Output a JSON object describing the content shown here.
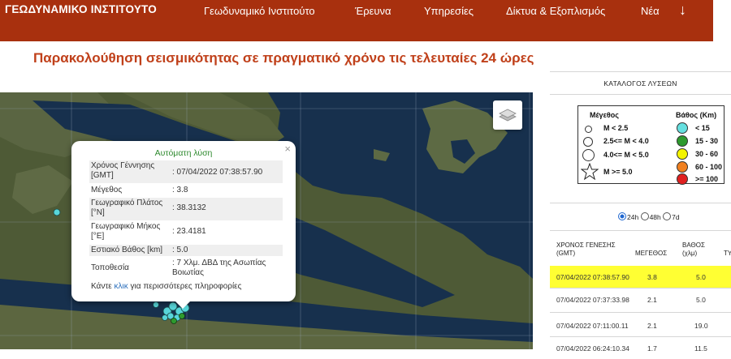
{
  "header": {
    "brand": "ΓΕΩΔΥΝΑΜΙΚΟ ΙΝΣΤΙΤΟΥΤΟ",
    "nav": [
      "Γεωδυναμικό Ινστιτούτο",
      "Έρευνα",
      "Υπηρεσίες",
      "Δίκτυα & Εξοπλισμός",
      "Νέα"
    ],
    "nav_arrow": "↓"
  },
  "page": {
    "title": "Παρακολούθηση σεισμικότητας σε πραγματικό χρόνο τις τελευταίες 24 ώρες"
  },
  "popup": {
    "title": "Αυτόματη λύση",
    "close": "×",
    "rows": [
      {
        "label": "Χρόνος Γέννησης [GMT]",
        "value": ": 07/04/2022 07:38:57.90"
      },
      {
        "label": "Μέγεθος",
        "value": ": 3.8"
      },
      {
        "label": "Γεωγραφικό Πλάτος [°N]",
        "value": ": 38.3132"
      },
      {
        "label": "Γεωγραφικό Μήκος [°E]",
        "value": ": 23.4181"
      },
      {
        "label": "Εστιακό Βάθος [km]",
        "value": ": 5.0"
      },
      {
        "label": "Τοποθεσία",
        "value": ": 7 Χλμ. ΔΒΔ της Ασωπίας Βοιωτίας"
      }
    ],
    "more_prefix": "Κάντε",
    "more_link": "κλικ",
    "more_suffix": "για περισσότερες πληροφορίες"
  },
  "right": {
    "title": "ΚΑΤΑΛΟΓΟΣ ΛΥΣΕΩΝ",
    "legend": {
      "mag_title": "Μέγεθος",
      "depth_title": "Βάθος (Km)",
      "mag": [
        "M < 2.5",
        "2.5<= M < 4.0",
        "4.0<= M < 5.0",
        "M >= 5.0"
      ],
      "depth": [
        "< 15",
        "15 - 30",
        "30 - 60",
        "60 - 100",
        ">= 100"
      ],
      "depth_colors": [
        "#66e0e0",
        "#2e9a2e",
        "#f4f400",
        "#f08020",
        "#e02020"
      ]
    },
    "ranges": [
      "24h",
      "48h",
      "7d"
    ],
    "table": {
      "headers": [
        "ΧΡΟΝΟΣ ΓΕΝΕΣΗΣ (GMT)",
        "ΜΕΓΕΘΟΣ",
        "ΒΑΘΟΣ (χλμ)",
        "ΤΥ"
      ],
      "rows": [
        {
          "time": "07/04/2022 07:38:57.90",
          "mag": "3.8",
          "depth": "5.0"
        },
        {
          "time": "07/04/2022 07:37:33.98",
          "mag": "2.1",
          "depth": "5.0"
        },
        {
          "time": "07/04/2022 07:11:00.11",
          "mag": "2.1",
          "depth": "19.0"
        },
        {
          "time": "07/04/2022 06:24:10.34",
          "mag": "1.7",
          "depth": "11.5"
        }
      ]
    }
  },
  "colors": {
    "header_bg": "#a8300e",
    "title": "#c0401a",
    "highlight": "#ffff33",
    "quake": "#58d6da"
  }
}
